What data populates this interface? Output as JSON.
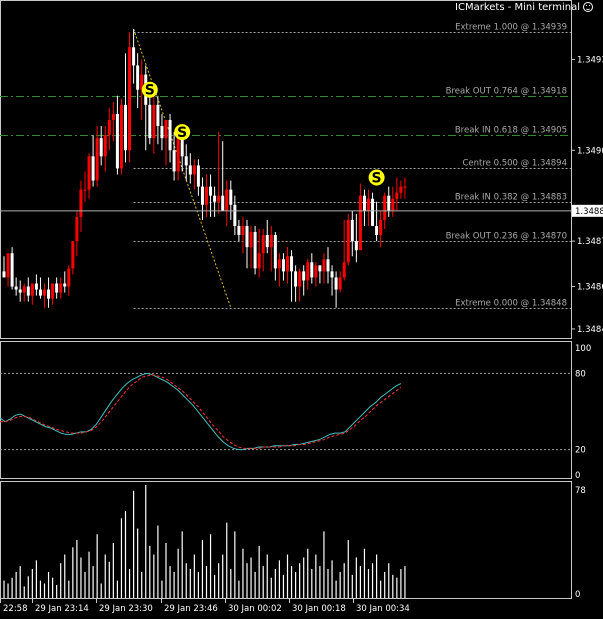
{
  "window": {
    "title": "ICMarkets - Mini terminal",
    "title_icon": "smiley-icon"
  },
  "colors": {
    "background": "#000000",
    "bull_candle": "#ff0000",
    "bear_candle": "#ffffff",
    "fib_line": "#a0a0a0",
    "break_line": "#2e8b2e",
    "signal_fill": "#ffff00",
    "main_line": "#40c0c0",
    "signal_line": "#ff3030",
    "zigzag": "#e0c020",
    "current_price_bg": "#ffffff"
  },
  "price_axis": {
    "labels": [
      "1.3493",
      "1.3490",
      "1.3488",
      "1.3487",
      "1.3486",
      "1.3484"
    ],
    "range": [
      1.34838,
      1.34945
    ],
    "current_price": "1.34880"
  },
  "fib_levels": [
    {
      "label": "Extreme 1.000 @ 1.34939",
      "price": 1.34939,
      "style": "fib"
    },
    {
      "label": "Break OUT 0.764 @ 1.34918",
      "price": 1.34918,
      "style": "break"
    },
    {
      "label": "Break IN 0.618 @ 1.34905",
      "price": 1.34905,
      "style": "break"
    },
    {
      "label": "Centre 0.500 @ 1.34894",
      "price": 1.34894,
      "style": "fib"
    },
    {
      "label": "Break IN 0.382 @ 1.34883",
      "price": 1.34883,
      "style": "fib"
    },
    {
      "label": "Break OUT 0.236 @ 1.34870",
      "price": 1.3487,
      "style": "fib"
    },
    {
      "label": "Extreme 0.000 @ 1.34848",
      "price": 1.34848,
      "style": "fib"
    }
  ],
  "signals": [
    {
      "letter": "S",
      "bar": 36,
      "price": 1.3492
    },
    {
      "letter": "S",
      "bar": 44,
      "price": 1.34906
    },
    {
      "letter": "S",
      "bar": 92,
      "price": 1.34891
    }
  ],
  "candles": {
    "opens": [
      1.3486,
      1.34858,
      1.34866,
      1.34855,
      1.34854,
      1.34853,
      1.34855,
      1.34852,
      1.34856,
      1.34854,
      1.34852,
      1.34854,
      1.34851,
      1.34856,
      1.34853,
      1.34856,
      1.34855,
      1.34861,
      1.3487,
      1.34878,
      1.34887,
      1.34887,
      1.34898,
      1.3489,
      1.34904,
      1.34898,
      1.34905,
      1.3491,
      1.34912,
      1.34894,
      1.34915,
      1.349,
      1.34934,
      1.34928,
      1.3492,
      1.34925,
      1.34915,
      1.34904,
      1.34915,
      1.34908,
      1.34904,
      1.3491,
      1.349,
      1.34893,
      1.34906,
      1.34898,
      1.34895,
      1.34892,
      1.34895,
      1.34888,
      1.34882,
      1.34888,
      1.34885,
      1.34883,
      1.34885,
      1.3488,
      1.34887,
      1.34882,
      1.34875,
      1.34872,
      1.34875,
      1.34868,
      1.34873,
      1.34861,
      1.34866,
      1.34872,
      1.34868,
      1.34872,
      1.34861,
      1.34864,
      1.3486,
      1.34865,
      1.3486,
      1.34855,
      1.3486,
      1.34857,
      1.34863,
      1.34858,
      1.34862,
      1.3486,
      1.34864,
      1.3486,
      1.34858,
      1.34854,
      1.34858,
      1.34863,
      1.34877,
      1.3487,
      1.34867,
      1.34885,
      1.3488,
      1.34884,
      1.34875,
      1.34872,
      1.34877,
      1.34885,
      1.3488,
      1.34884,
      1.34886,
      1.34888
    ],
    "highs": [
      1.34865,
      1.34862,
      1.34868,
      1.34858,
      1.34857,
      1.34856,
      1.34858,
      1.34856,
      1.34859,
      1.34858,
      1.34856,
      1.34858,
      1.34855,
      1.34858,
      1.34858,
      1.3486,
      1.34862,
      1.3487,
      1.3488,
      1.3489,
      1.34893,
      1.34899,
      1.34905,
      1.34908,
      1.34908,
      1.34908,
      1.34914,
      1.34916,
      1.34918,
      1.34917,
      1.34932,
      1.34939,
      1.3494,
      1.34932,
      1.3493,
      1.34928,
      1.3492,
      1.34918,
      1.34918,
      1.34912,
      1.34908,
      1.34912,
      1.34906,
      1.34906,
      1.34908,
      1.34902,
      1.34899,
      1.34897,
      1.34897,
      1.34891,
      1.34892,
      1.34892,
      1.34888,
      1.34906,
      1.34903,
      1.3489,
      1.3489,
      1.34885,
      1.34877,
      1.34878,
      1.34877,
      1.34875,
      1.34875,
      1.34874,
      1.34874,
      1.34877,
      1.34875,
      1.34873,
      1.34866,
      1.34866,
      1.34868,
      1.34867,
      1.34862,
      1.34861,
      1.34862,
      1.34864,
      1.34866,
      1.34863,
      1.34862,
      1.34866,
      1.34868,
      1.34862,
      1.3486,
      1.3486,
      1.34877,
      1.34879,
      1.3488,
      1.34879,
      1.34889,
      1.34887,
      1.34887,
      1.34886,
      1.34883,
      1.3488,
      1.34886,
      1.34888,
      1.34888,
      1.34891,
      1.3489,
      1.34891
    ],
    "lows": [
      1.34858,
      1.34855,
      1.34854,
      1.34852,
      1.3485,
      1.3485,
      1.3485,
      1.34849,
      1.34852,
      1.34851,
      1.34848,
      1.34848,
      1.34849,
      1.34851,
      1.34851,
      1.34853,
      1.34852,
      1.34859,
      1.34865,
      1.34873,
      1.34883,
      1.34884,
      1.34888,
      1.34888,
      1.34895,
      1.34893,
      1.349,
      1.34903,
      1.34892,
      1.34892,
      1.34896,
      1.34896,
      1.34922,
      1.34914,
      1.3491,
      1.349,
      1.34902,
      1.34899,
      1.34902,
      1.349,
      1.34895,
      1.34896,
      1.3489,
      1.3489,
      1.34893,
      1.3489,
      1.34889,
      1.34887,
      1.34885,
      1.34877,
      1.34878,
      1.34878,
      1.34878,
      1.34879,
      1.3488,
      1.34875,
      1.34877,
      1.34872,
      1.3487,
      1.34866,
      1.34861,
      1.34861,
      1.34859,
      1.34858,
      1.3486,
      1.34866,
      1.3486,
      1.34857,
      1.34855,
      1.34857,
      1.34856,
      1.3485,
      1.3485,
      1.3485,
      1.34852,
      1.34854,
      1.34856,
      1.34855,
      1.34856,
      1.34856,
      1.34856,
      1.34852,
      1.34848,
      1.34853,
      1.34857,
      1.34862,
      1.34865,
      1.34863,
      1.34867,
      1.34875,
      1.34875,
      1.34875,
      1.3487,
      1.34868,
      1.34874,
      1.34878,
      1.34878,
      1.3488,
      1.34884,
      1.34884
    ],
    "closes": [
      1.34858,
      1.34866,
      1.34855,
      1.34854,
      1.34853,
      1.34855,
      1.34852,
      1.34856,
      1.34854,
      1.34852,
      1.34854,
      1.34851,
      1.34856,
      1.34853,
      1.34856,
      1.34855,
      1.34861,
      1.3487,
      1.34878,
      1.34887,
      1.34887,
      1.34898,
      1.3489,
      1.34904,
      1.34898,
      1.34905,
      1.3491,
      1.34912,
      1.34894,
      1.34915,
      1.349,
      1.34934,
      1.34928,
      1.3492,
      1.34925,
      1.34915,
      1.34904,
      1.34915,
      1.34908,
      1.34904,
      1.3491,
      1.349,
      1.34893,
      1.34906,
      1.34898,
      1.34895,
      1.34892,
      1.34895,
      1.34888,
      1.34882,
      1.34888,
      1.34885,
      1.34883,
      1.34885,
      1.3488,
      1.34887,
      1.34882,
      1.34875,
      1.34872,
      1.34875,
      1.34868,
      1.34873,
      1.34861,
      1.34866,
      1.34872,
      1.34868,
      1.34872,
      1.34861,
      1.34864,
      1.3486,
      1.34865,
      1.3486,
      1.34855,
      1.3486,
      1.34857,
      1.34863,
      1.34858,
      1.34862,
      1.3486,
      1.34864,
      1.3486,
      1.34858,
      1.34854,
      1.34858,
      1.34863,
      1.34877,
      1.3487,
      1.34867,
      1.34885,
      1.3488,
      1.34884,
      1.34875,
      1.34872,
      1.34877,
      1.34885,
      1.3488,
      1.34884,
      1.34886,
      1.34888,
      1.34888
    ]
  },
  "zigzag": [
    {
      "bar": 32,
      "price": 1.3494
    },
    {
      "bar": 56,
      "price": 1.34848
    }
  ],
  "oscillator": {
    "levels": [
      "100",
      "80",
      "20",
      "0"
    ],
    "level_values": [
      80,
      20
    ],
    "main": [
      45,
      42,
      44,
      47,
      48,
      46,
      44,
      42,
      40,
      38,
      37,
      35,
      33,
      32,
      32,
      33,
      34,
      34,
      36,
      40,
      46,
      52,
      58,
      63,
      68,
      72,
      75,
      77,
      79,
      80,
      79,
      77,
      75,
      73,
      70,
      67,
      63,
      59,
      55,
      50,
      45,
      40,
      35,
      30,
      26,
      23,
      21,
      20,
      20,
      21,
      21,
      22,
      22,
      22,
      23,
      23,
      23,
      23,
      24,
      24,
      25,
      26,
      27,
      28,
      30,
      32,
      33,
      33,
      34,
      38,
      42,
      46,
      50,
      54,
      57,
      61,
      64,
      67,
      70,
      72
    ],
    "signal": [
      42,
      42,
      43,
      45,
      46,
      46,
      45,
      43,
      41,
      39,
      38,
      36,
      35,
      34,
      33,
      33,
      33,
      34,
      35,
      38,
      42,
      47,
      52,
      57,
      62,
      67,
      71,
      74,
      77,
      78,
      79,
      78,
      77,
      75,
      72,
      69,
      66,
      62,
      58,
      54,
      49,
      44,
      39,
      35,
      30,
      27,
      24,
      22,
      21,
      21,
      21,
      21,
      22,
      22,
      22,
      22,
      23,
      23,
      23,
      24,
      24,
      25,
      26,
      27,
      28,
      30,
      31,
      32,
      33,
      36,
      39,
      43,
      46,
      50,
      54,
      57,
      60,
      63,
      66,
      69
    ]
  },
  "volume": {
    "axis_top": "78",
    "axis_bottom": "0",
    "max": 78,
    "values": [
      12,
      10,
      14,
      18,
      22,
      8,
      15,
      20,
      26,
      12,
      10,
      18,
      14,
      9,
      24,
      30,
      12,
      35,
      40,
      28,
      18,
      32,
      22,
      44,
      10,
      30,
      25,
      38,
      12,
      55,
      60,
      20,
      74,
      48,
      18,
      78,
      36,
      30,
      50,
      12,
      38,
      22,
      18,
      34,
      46,
      24,
      20,
      30,
      18,
      40,
      22,
      44,
      16,
      24,
      30,
      52,
      20,
      46,
      12,
      34,
      24,
      28,
      18,
      36,
      22,
      30,
      14,
      20,
      26,
      16,
      30,
      22,
      18,
      24,
      28,
      34,
      20,
      30,
      22,
      46,
      20,
      26,
      12,
      18,
      24,
      40,
      16,
      28,
      22,
      34,
      20,
      24,
      30,
      12,
      18,
      24,
      16,
      14,
      20,
      22
    ]
  },
  "time_axis": {
    "labels": [
      "22:58",
      "29 Jan 23:14",
      "29 Jan 23:30",
      "29 Jan 23:46",
      "30 Jan 00:02",
      "30 Jan 00:18",
      "30 Jan 00:34"
    ]
  }
}
